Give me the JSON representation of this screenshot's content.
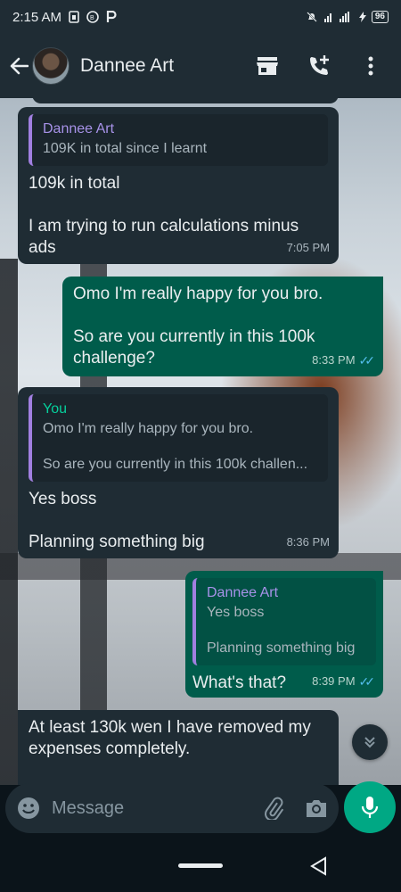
{
  "status_bar": {
    "time": "2:15 AM",
    "battery": "96"
  },
  "header": {
    "contact_name": "Dannee Art"
  },
  "messages": [
    {
      "direction": "in",
      "quote_author": "Dannee Art",
      "quote_text": "109K in total since I learnt",
      "text": "109k in total\n\nI am trying to run calculations minus ads",
      "time": "7:05 PM"
    },
    {
      "direction": "out",
      "text": "Omo I'm really happy for you bro.\n\nSo are you currently in this 100k challenge?",
      "time": "8:33 PM"
    },
    {
      "direction": "in",
      "quote_author": "You",
      "quote_line1": "Omo I'm really happy for you bro.",
      "quote_line2": "So are you currently in this 100k challen...",
      "text": "Yes boss\n\nPlanning something big",
      "time": "8:36 PM"
    },
    {
      "direction": "out",
      "quote_author": "Dannee Art",
      "quote_line1": "Yes boss",
      "quote_line2": "Planning something big",
      "text": "What's that?",
      "time": "8:39 PM"
    },
    {
      "direction": "in",
      "text": "At least 130k wen I have removed my expenses completely."
    }
  ],
  "composer": {
    "placeholder": "Message"
  },
  "colors": {
    "accent": "#00a884",
    "outgoing_bubble": "#005c4b",
    "incoming_bubble": "#1f2c34",
    "read_ticks": "#53bdeb"
  }
}
